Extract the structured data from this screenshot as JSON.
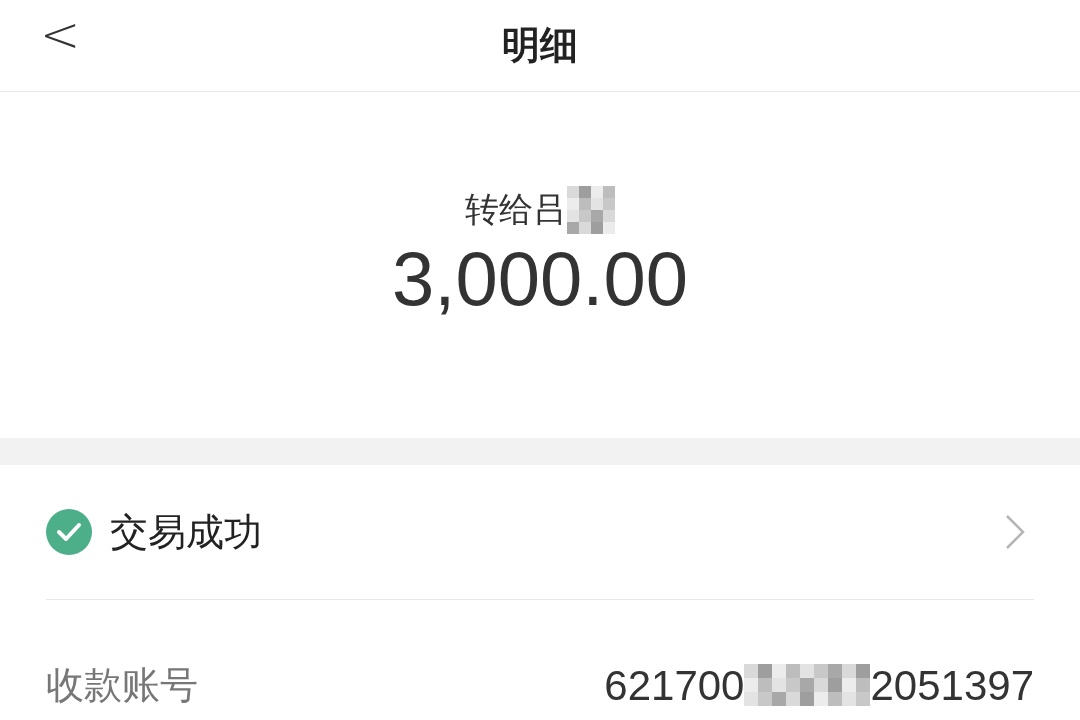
{
  "header": {
    "back": "<",
    "title": "明细"
  },
  "summary": {
    "recipient": "转给吕",
    "amount": "3,000.00"
  },
  "status": {
    "text": "交易成功"
  },
  "details": [
    {
      "label": "收款账号",
      "value_start": "621700",
      "value_end": "2051397"
    }
  ]
}
